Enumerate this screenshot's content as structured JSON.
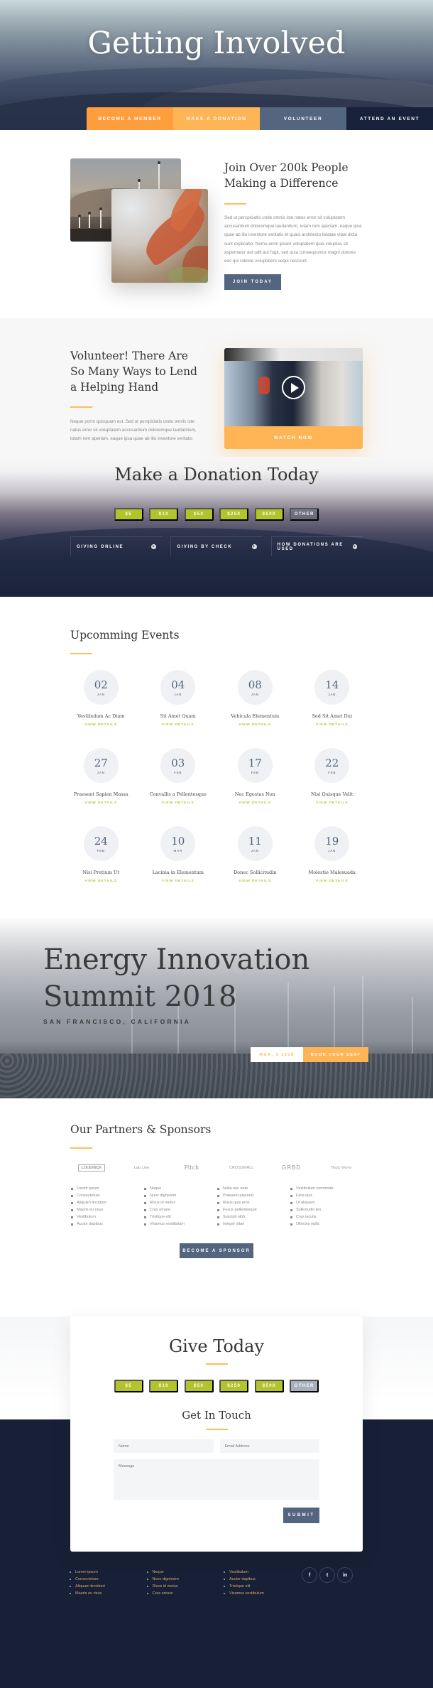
{
  "hero": {
    "title": "Getting Involved",
    "tabs": [
      {
        "label": "Become a Member",
        "color": "#ff9e3d"
      },
      {
        "label": "Make a Donation",
        "color": "#ffb455"
      },
      {
        "label": "Volunteer",
        "color": "#53657f"
      },
      {
        "label": "Attend an Event",
        "color": "#18213a"
      }
    ]
  },
  "join": {
    "title": "Join Over 200k People Making a Difference",
    "body": "Sed ut perspiciatis unde omnis iste natus error sit voluptatem accusantium doloremque laudantium, totam rem aperiam, eaque ipsa quae ab illo inventore veritatis et quasi architecto beatae vitae dicta sunt explicabo. Nemo enim ipsam voluptatem quia voluptas sit aspernatur aut odit aut fugit, sed quia consequuntur magni dolores eos qui ratione voluptatem sequi nesciunt.",
    "button": "Join Today"
  },
  "volunteer": {
    "title": "Volunteer! There Are So Many Ways to Lend a Helping Hand",
    "body": "Neque porro quisquam est. Sed ut perspiciatis unde omnis iste natus error sit voluptatem accusantium doloremque laudantium, totam rem aperiam, eaque ipsa quae ab illo inventore veritatis",
    "video_button": "Watch Now"
  },
  "donation": {
    "title": "Make a Donation Today",
    "amounts": [
      "$5",
      "$10",
      "$50",
      "$250",
      "$500",
      "Other"
    ],
    "toggles": [
      "Giving Online",
      "Giving by Check",
      "How Donations Are Used"
    ]
  },
  "events": {
    "title": "Upcomming Events",
    "details_label": "View Details",
    "items": [
      {
        "day": "02",
        "month": "JAN",
        "name": "Vestibulum Ac Diam"
      },
      {
        "day": "04",
        "month": "JAN",
        "name": "Sit Amet Quam"
      },
      {
        "day": "08",
        "month": "JAN",
        "name": "Vehicula Elementum"
      },
      {
        "day": "14",
        "month": "JAN",
        "name": "Sed Sit Amet Dui"
      },
      {
        "day": "27",
        "month": "JAN",
        "name": "Praesent Sapien Massa"
      },
      {
        "day": "03",
        "month": "FEB",
        "name": "Convallis a Pellentesque"
      },
      {
        "day": "17",
        "month": "FEB",
        "name": "Nec Egestas Non"
      },
      {
        "day": "22",
        "month": "FEB",
        "name": "Nisi Quisque Velit"
      },
      {
        "day": "24",
        "month": "FEB",
        "name": "Nisi Pretium Ut"
      },
      {
        "day": "10",
        "month": "MAR",
        "name": "Lacinia in Elementum"
      },
      {
        "day": "11",
        "month": "JAN",
        "name": "Donec Sollicitudin"
      },
      {
        "day": "19",
        "month": "JAN",
        "name": "Molestie Malesuada"
      }
    ]
  },
  "summit": {
    "title_line1": "Energy Innovation",
    "title_line2": "Summit 2018",
    "location": "San Francisco, California",
    "date": "Mar, 3 2019",
    "button": "Book Your Seat"
  },
  "partners": {
    "title": "Our Partners & Sponsors",
    "logos": [
      "LOUDNICK",
      "Lab Line",
      "Pitch",
      "CROSSWALL",
      "GRBD",
      "Real Wave"
    ],
    "lists": [
      [
        "Lorem ipsum",
        "Consectetuer.",
        "Aliquam tincidunt",
        "Mauris eu risus",
        "Vestibulum",
        "Auctor dapibus"
      ],
      [
        "Neque",
        "Nunc dignissim",
        "Risus id metus",
        "Cras ornare",
        "Tristique elit",
        "Vivamus vestibulum"
      ],
      [
        "Nulla nec ante",
        "Praesent placerat",
        "Risus quis eros",
        "Fusce pellentesque",
        "Suscipit nibh.",
        "Integer vitae"
      ],
      [
        "Vestibulum commodo",
        "Felis quis",
        "Ut aliquam",
        "Sollicitudin leo",
        "Cras iaculis",
        "Ultricies nulla"
      ]
    ],
    "button": "Become a Sponsor"
  },
  "give": {
    "title": "Give Today",
    "amounts": [
      "$5",
      "$10",
      "$50",
      "$250",
      "$500",
      "Other"
    ]
  },
  "contact": {
    "title": "Get In Touch",
    "name_placeholder": "Name",
    "email_placeholder": "Email Address",
    "message_placeholder": "Message",
    "submit": "Submit"
  },
  "footer": {
    "lists": [
      [
        "Lorem ipsum",
        "Consectetuer.",
        "Aliquam tincidunt",
        "Mauris eu risus"
      ],
      [
        "Neque",
        "Nunc dignissim",
        "Risus id metus",
        "Cras ornare"
      ],
      [
        "Vestibulum",
        "Auctor dapibus",
        "Tristique elit",
        "Vivamus vestibulum"
      ]
    ],
    "social": [
      {
        "name": "facebook",
        "glyph": "f"
      },
      {
        "name": "twitter",
        "glyph": "t"
      },
      {
        "name": "linkedin",
        "glyph": "in"
      }
    ]
  }
}
